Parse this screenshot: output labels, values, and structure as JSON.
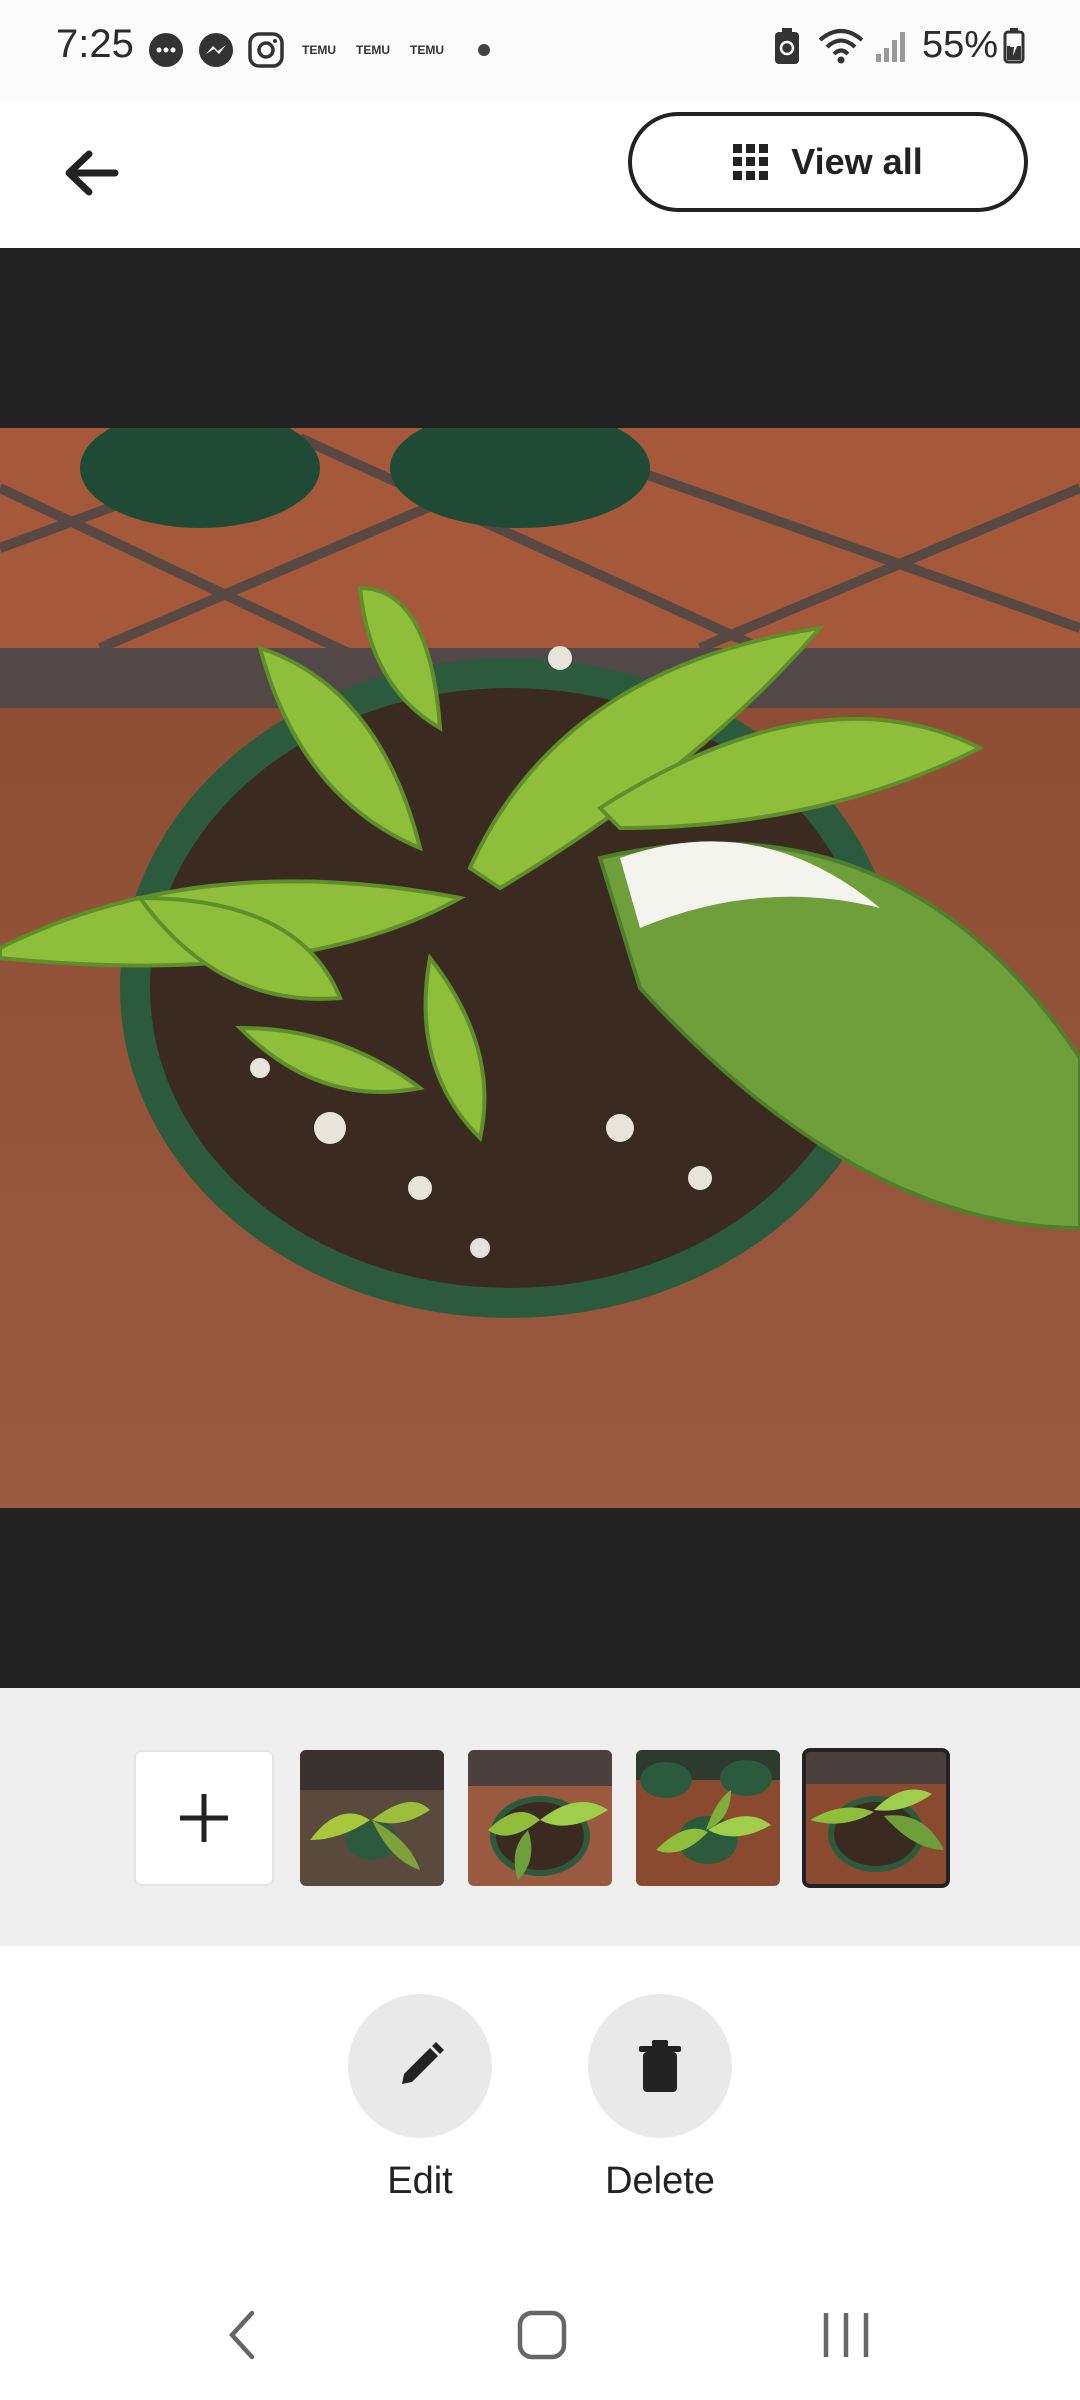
{
  "status_bar": {
    "time": "7:25",
    "temu_labels": [
      "TEMU",
      "TEMU",
      "TEMU"
    ],
    "battery": "55%",
    "icons": [
      "messages-icon",
      "messenger-icon",
      "instagram-icon",
      "battery-saver-icon",
      "wifi-icon",
      "signal-icon",
      "battery-icon"
    ]
  },
  "top_bar": {
    "back_icon": "back-arrow-icon",
    "view_all_label": "View all",
    "view_all_icon": "grid-icon"
  },
  "photos": {
    "selected_index": 4,
    "thumbnails": [
      "photo-1",
      "photo-2",
      "photo-3",
      "photo-4"
    ],
    "add_icon": "plus-icon"
  },
  "actions": {
    "edit_label": "Edit",
    "delete_label": "Delete"
  },
  "nav_bar": {
    "icons": [
      "back-icon",
      "home-icon",
      "recents-icon"
    ]
  },
  "colors": {
    "viewer_bg": "#222222",
    "strip_bg": "#efefef",
    "action_bg": "#e9e9e9",
    "text": "#222222"
  }
}
